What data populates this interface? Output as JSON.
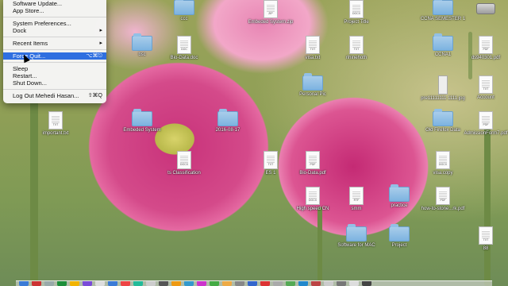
{
  "apple_menu": {
    "items": [
      {
        "label": "Software Update...",
        "shortcut": ""
      },
      {
        "label": "App Store...",
        "shortcut": ""
      },
      {
        "sep": true
      },
      {
        "label": "System Preferences...",
        "shortcut": ""
      },
      {
        "label": "Dock",
        "shortcut": "▸"
      },
      {
        "sep": true
      },
      {
        "label": "Recent Items",
        "shortcut": "▸"
      },
      {
        "sep": true
      },
      {
        "label": "Force Quit...",
        "shortcut": "⌥⌘⎋",
        "selected": true
      },
      {
        "sep": true
      },
      {
        "label": "Sleep",
        "shortcut": ""
      },
      {
        "label": "Restart...",
        "shortcut": ""
      },
      {
        "label": "Shut Down...",
        "shortcut": ""
      },
      {
        "sep": true
      },
      {
        "label": "Log Out Mehedi Hasan...",
        "shortcut": "⇧⌘Q"
      }
    ]
  },
  "desktop_icons": [
    {
      "label": "ccc",
      "kind": "folder"
    },
    {
      "label": "Embeded System.zip",
      "kind": "doc",
      "tag": "ZIP"
    },
    {
      "label": "Project Title",
      "kind": "doc",
      "tag": "DOCX"
    },
    {
      "label": "CCNA SEMESTER 1",
      "kind": "folder"
    },
    {
      "label": "",
      "kind": "drive"
    },
    {
      "label": "bsc",
      "kind": "folder"
    },
    {
      "label": "Bio-Data.doc",
      "kind": "doc",
      "tag": "DOC"
    },
    {
      "label": "visa.txt",
      "kind": "doc",
      "tag": "TXT"
    },
    {
      "label": "rihinehoth",
      "kind": "doc",
      "tag": "TXT"
    },
    {
      "label": "CCNA1",
      "kind": "folder"
    },
    {
      "label": "ds940301.pdf",
      "kind": "doc",
      "tag": "PDF"
    },
    {
      "label": "Personal Pic",
      "kind": "folder"
    },
    {
      "label": "pre11111111 1111.jpg",
      "kind": "image"
    },
    {
      "label": "Account",
      "kind": "doc",
      "tag": "TXT"
    },
    {
      "label": "important.txt",
      "kind": "doc",
      "tag": "TXT"
    },
    {
      "label": "Embeded System",
      "kind": "folder"
    },
    {
      "label": "2016-08-17",
      "kind": "folder"
    },
    {
      "label": "Old Firefox Data",
      "kind": "folder"
    },
    {
      "label": "AdmissionForm7.pdf",
      "kind": "doc",
      "tag": "PDF"
    },
    {
      "label": "ts Classification",
      "kind": "doc",
      "tag": "DOCX"
    },
    {
      "label": "ES 1",
      "kind": "doc",
      "tag": "TXT"
    },
    {
      "label": "Bio-Data.pdf",
      "kind": "doc",
      "tag": "PDF"
    },
    {
      "label": "visa.copy",
      "kind": "doc",
      "tag": "DOCX"
    },
    {
      "label": "High speed CN",
      "kind": "doc",
      "tag": "DOCX"
    },
    {
      "label": "smm",
      "kind": "doc",
      "tag": "RTF"
    },
    {
      "label": "practice",
      "kind": "folder"
    },
    {
      "label": "how-to-stone...rk.pdf",
      "kind": "doc",
      "tag": "PDF"
    },
    {
      "label": "Software for MAC",
      "kind": "folder"
    },
    {
      "label": "Project",
      "kind": "folder"
    },
    {
      "label": "88",
      "kind": "doc",
      "tag": "TXT"
    }
  ],
  "dock": {
    "apps": [
      "#3b7bd6",
      "#c33",
      "#9aa",
      "#1d8f3a",
      "#f2b400",
      "#7a4bd8",
      "#ddd",
      "#3b7bd6",
      "#e44",
      "#2b9",
      "#ccc",
      "#555",
      "#e91",
      "#39c",
      "#c3c",
      "#4a4",
      "#ea4",
      "#888",
      "#36c",
      "#d33",
      "#aaa",
      "#5a5",
      "#28c",
      "#b44",
      "#ccc",
      "#777",
      "#ddd",
      "#444"
    ]
  }
}
